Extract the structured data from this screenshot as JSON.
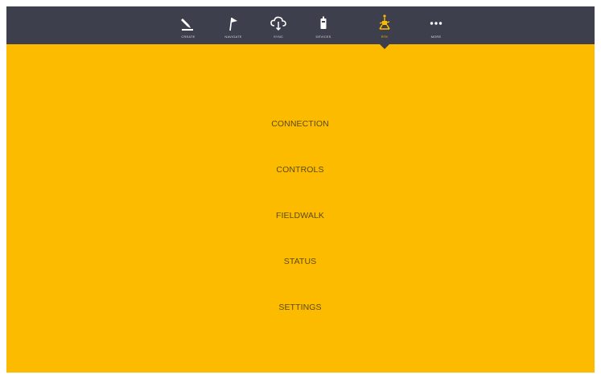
{
  "nav": {
    "items": [
      {
        "label": "Create",
        "icon": "pencil-icon"
      },
      {
        "label": "Navigate",
        "icon": "flag-icon"
      },
      {
        "label": "Sync",
        "icon": "cloud-sync-icon"
      },
      {
        "label": "Devices",
        "icon": "device-icon"
      },
      {
        "label": "Rtk",
        "icon": "robot-icon"
      },
      {
        "label": "More",
        "icon": "dots-icon"
      }
    ],
    "active": "Rtk"
  },
  "menu": {
    "items": [
      {
        "label": "CONNECTION"
      },
      {
        "label": "CONTROLS"
      },
      {
        "label": "FIELDWALK"
      },
      {
        "label": "STATUS"
      },
      {
        "label": "SETTINGS"
      }
    ]
  },
  "colors": {
    "background": "#fdbb00",
    "topbar": "#3d3f4d",
    "menu_text": "#5a4a12",
    "icon": "#ffffff",
    "active_icon": "#fdbb00"
  }
}
